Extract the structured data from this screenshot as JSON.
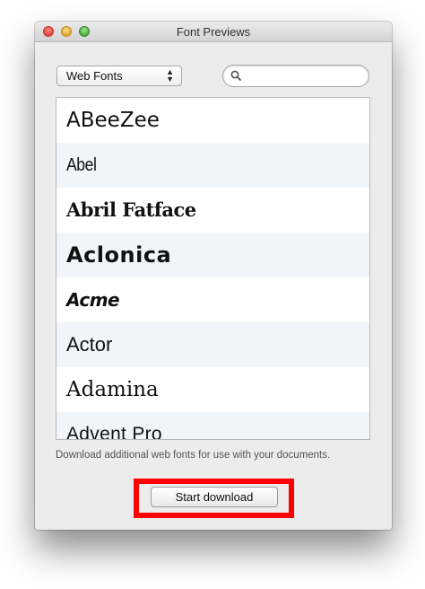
{
  "window": {
    "title": "Font Previews"
  },
  "toolbar": {
    "font_source_selected": "Web Fonts",
    "search_placeholder": "",
    "search_value": ""
  },
  "fonts": [
    "ABeeZee",
    "Abel",
    "Abril Fatface",
    "Aclonica",
    "Acme",
    "Actor",
    "Adamina",
    "Advent Pro"
  ],
  "footer": {
    "note": "Download additional web fonts for use with your documents.",
    "download_label": "Start download"
  },
  "colors": {
    "highlight": "#ff0000",
    "row_alt": "#f1f4f9"
  }
}
